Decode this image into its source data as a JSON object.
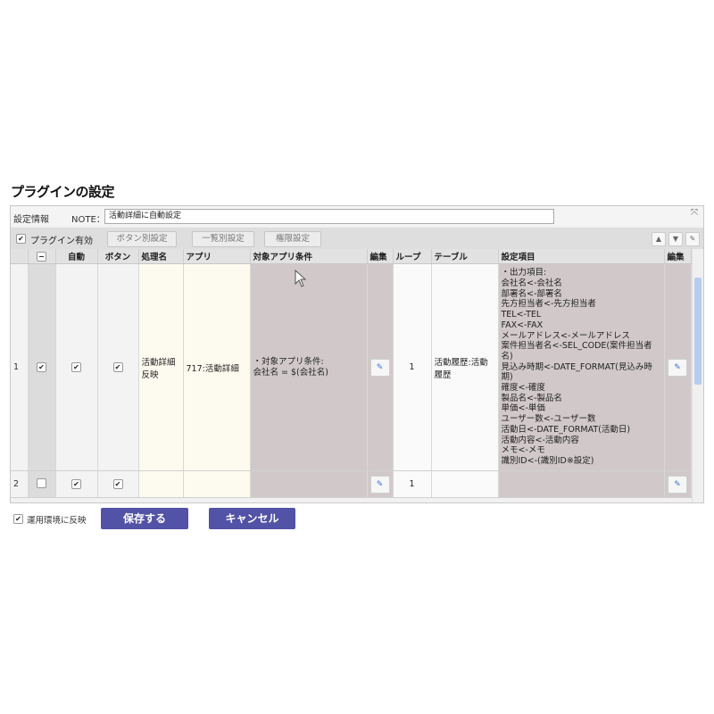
{
  "page": {
    "title": "プラグインの設定"
  },
  "note_row": {
    "settings_label": "設定情報",
    "note_label": "NOTE：",
    "note_value": "活動詳細に自動設定"
  },
  "toolbar": {
    "enabled_checked": true,
    "enabled_label": "プラグイン有効",
    "buttons": [
      "ボタン別設定",
      "一覧別設定",
      "権限設定"
    ]
  },
  "table": {
    "headers": [
      "",
      "",
      "自動",
      "ボタン",
      "処理名",
      "アプリ",
      "対象アプリ条件",
      "編集",
      "ループ",
      "テーブル",
      "設定項目",
      "編集"
    ],
    "rows": [
      {
        "num": "1",
        "selected": true,
        "auto": true,
        "button": true,
        "process_name": "活動詳細反映",
        "app": "717:活動詳細",
        "condition": "・対象アプリ条件:\n会社名 = $(会社名)",
        "loop": "1",
        "table": "活動履歴:活動履歴",
        "settings": "・出力項目:\n会社名<-会社名\n部署名<-部署名\n先方担当者<-先方担当者\nTEL<-TEL\nFAX<-FAX\nメールアドレス<-メールアドレス\n案件担当者名<-SEL_CODE(案件担当者名)\n見込み時期<-DATE_FORMAT(見込み時期)\n確度<-確度\n製品名<-製品名\n単価<-単価\nユーザー数<-ユーザー数\n活動日<-DATE_FORMAT(活動日)\n活動内容<-活動内容\nメモ<-メモ\n識別ID<-(識別ID※設定)"
      },
      {
        "num": "2",
        "selected": false,
        "auto": true,
        "button": true,
        "process_name": "",
        "app": "",
        "condition": "",
        "loop": "1",
        "table": "",
        "settings": ""
      }
    ]
  },
  "footer": {
    "apply_checked": true,
    "apply_label": "運用環境に反映",
    "save_label": "保存する",
    "cancel_label": "キャンセル"
  }
}
